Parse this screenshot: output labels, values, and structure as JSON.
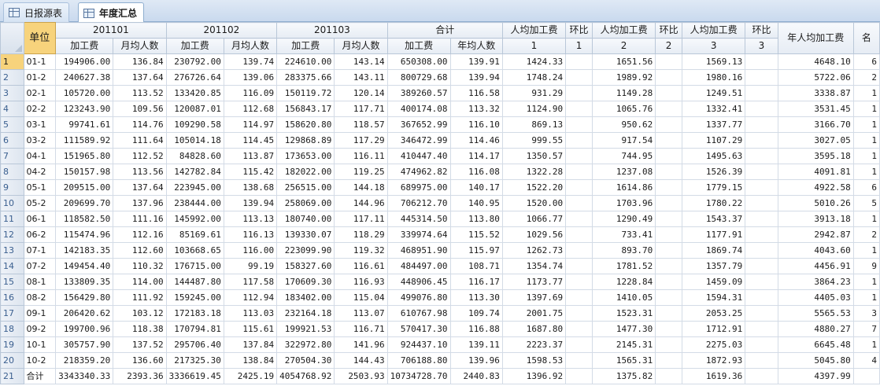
{
  "tabs": [
    {
      "label": "日报源表",
      "active": false
    },
    {
      "label": "年度汇总",
      "active": true
    }
  ],
  "headers": {
    "unit": "单位",
    "groups": [
      "201101",
      "201102",
      "201103",
      "合计"
    ],
    "sub_cost": "加工费",
    "sub_avg": "月均人数",
    "sub_yavg": "年均人数",
    "per_capita": "人均加工费",
    "ratio": "环比",
    "nums": [
      "1",
      "1",
      "2",
      "2",
      "3",
      "3"
    ],
    "year_per": "年人均加工费",
    "rank": "名"
  },
  "rows": [
    [
      "1",
      "01-1",
      "194906.00",
      "136.84",
      "230792.00",
      "139.74",
      "224610.00",
      "143.14",
      "650308.00",
      "139.91",
      "1424.33",
      "",
      "1651.56",
      "",
      "1569.13",
      "",
      "4648.10",
      "6"
    ],
    [
      "2",
      "01-2",
      "240627.38",
      "137.64",
      "276726.64",
      "139.06",
      "283375.66",
      "143.11",
      "800729.68",
      "139.94",
      "1748.24",
      "",
      "1989.92",
      "",
      "1980.16",
      "",
      "5722.06",
      "2"
    ],
    [
      "3",
      "02-1",
      "105720.00",
      "113.52",
      "133420.85",
      "116.09",
      "150119.72",
      "120.14",
      "389260.57",
      "116.58",
      "931.29",
      "",
      "1149.28",
      "",
      "1249.51",
      "",
      "3338.87",
      "1"
    ],
    [
      "4",
      "02-2",
      "123243.90",
      "109.56",
      "120087.01",
      "112.68",
      "156843.17",
      "117.71",
      "400174.08",
      "113.32",
      "1124.90",
      "",
      "1065.76",
      "",
      "1332.41",
      "",
      "3531.45",
      "1"
    ],
    [
      "5",
      "03-1",
      "99741.61",
      "114.76",
      "109290.58",
      "114.97",
      "158620.80",
      "118.57",
      "367652.99",
      "116.10",
      "869.13",
      "",
      "950.62",
      "",
      "1337.77",
      "",
      "3166.70",
      "1"
    ],
    [
      "6",
      "03-2",
      "111589.92",
      "111.64",
      "105014.18",
      "114.45",
      "129868.89",
      "117.29",
      "346472.99",
      "114.46",
      "999.55",
      "",
      "917.54",
      "",
      "1107.29",
      "",
      "3027.05",
      "1"
    ],
    [
      "7",
      "04-1",
      "151965.80",
      "112.52",
      "84828.60",
      "113.87",
      "173653.00",
      "116.11",
      "410447.40",
      "114.17",
      "1350.57",
      "",
      "744.95",
      "",
      "1495.63",
      "",
      "3595.18",
      "1"
    ],
    [
      "8",
      "04-2",
      "150157.98",
      "113.56",
      "142782.84",
      "115.42",
      "182022.00",
      "119.25",
      "474962.82",
      "116.08",
      "1322.28",
      "",
      "1237.08",
      "",
      "1526.39",
      "",
      "4091.81",
      "1"
    ],
    [
      "9",
      "05-1",
      "209515.00",
      "137.64",
      "223945.00",
      "138.68",
      "256515.00",
      "144.18",
      "689975.00",
      "140.17",
      "1522.20",
      "",
      "1614.86",
      "",
      "1779.15",
      "",
      "4922.58",
      "6"
    ],
    [
      "10",
      "05-2",
      "209699.70",
      "137.96",
      "238444.00",
      "139.94",
      "258069.00",
      "144.96",
      "706212.70",
      "140.95",
      "1520.00",
      "",
      "1703.96",
      "",
      "1780.22",
      "",
      "5010.26",
      "5"
    ],
    [
      "11",
      "06-1",
      "118582.50",
      "111.16",
      "145992.00",
      "113.13",
      "180740.00",
      "117.11",
      "445314.50",
      "113.80",
      "1066.77",
      "",
      "1290.49",
      "",
      "1543.37",
      "",
      "3913.18",
      "1"
    ],
    [
      "12",
      "06-2",
      "115474.96",
      "112.16",
      "85169.61",
      "116.13",
      "139330.07",
      "118.29",
      "339974.64",
      "115.52",
      "1029.56",
      "",
      "733.41",
      "",
      "1177.91",
      "",
      "2942.87",
      "2"
    ],
    [
      "13",
      "07-1",
      "142183.35",
      "112.60",
      "103668.65",
      "116.00",
      "223099.90",
      "119.32",
      "468951.90",
      "115.97",
      "1262.73",
      "",
      "893.70",
      "",
      "1869.74",
      "",
      "4043.60",
      "1"
    ],
    [
      "14",
      "07-2",
      "149454.40",
      "110.32",
      "176715.00",
      "99.19",
      "158327.60",
      "116.61",
      "484497.00",
      "108.71",
      "1354.74",
      "",
      "1781.52",
      "",
      "1357.79",
      "",
      "4456.91",
      "9"
    ],
    [
      "15",
      "08-1",
      "133809.35",
      "114.00",
      "144487.80",
      "117.58",
      "170609.30",
      "116.93",
      "448906.45",
      "116.17",
      "1173.77",
      "",
      "1228.84",
      "",
      "1459.09",
      "",
      "3864.23",
      "1"
    ],
    [
      "16",
      "08-2",
      "156429.80",
      "111.92",
      "159245.00",
      "112.94",
      "183402.00",
      "115.04",
      "499076.80",
      "113.30",
      "1397.69",
      "",
      "1410.05",
      "",
      "1594.31",
      "",
      "4405.03",
      "1"
    ],
    [
      "17",
      "09-1",
      "206420.62",
      "103.12",
      "172183.18",
      "113.03",
      "232164.18",
      "113.07",
      "610767.98",
      "109.74",
      "2001.75",
      "",
      "1523.31",
      "",
      "2053.25",
      "",
      "5565.53",
      "3"
    ],
    [
      "18",
      "09-2",
      "199700.96",
      "118.38",
      "170794.81",
      "115.61",
      "199921.53",
      "116.71",
      "570417.30",
      "116.88",
      "1687.80",
      "",
      "1477.30",
      "",
      "1712.91",
      "",
      "4880.27",
      "7"
    ],
    [
      "19",
      "10-1",
      "305757.90",
      "137.52",
      "295706.40",
      "137.84",
      "322972.80",
      "141.96",
      "924437.10",
      "139.11",
      "2223.37",
      "",
      "2145.31",
      "",
      "2275.03",
      "",
      "6645.48",
      "1"
    ],
    [
      "20",
      "10-2",
      "218359.20",
      "136.60",
      "217325.30",
      "138.84",
      "270504.30",
      "144.43",
      "706188.80",
      "139.96",
      "1598.53",
      "",
      "1565.31",
      "",
      "1872.93",
      "",
      "5045.80",
      "4"
    ],
    [
      "21",
      "合计",
      "3343340.33",
      "2393.36",
      "3336619.45",
      "2425.19",
      "4054768.92",
      "2503.93",
      "10734728.70",
      "2440.83",
      "1396.92",
      "",
      "1375.82",
      "",
      "1619.36",
      "",
      "4397.99",
      ""
    ]
  ]
}
